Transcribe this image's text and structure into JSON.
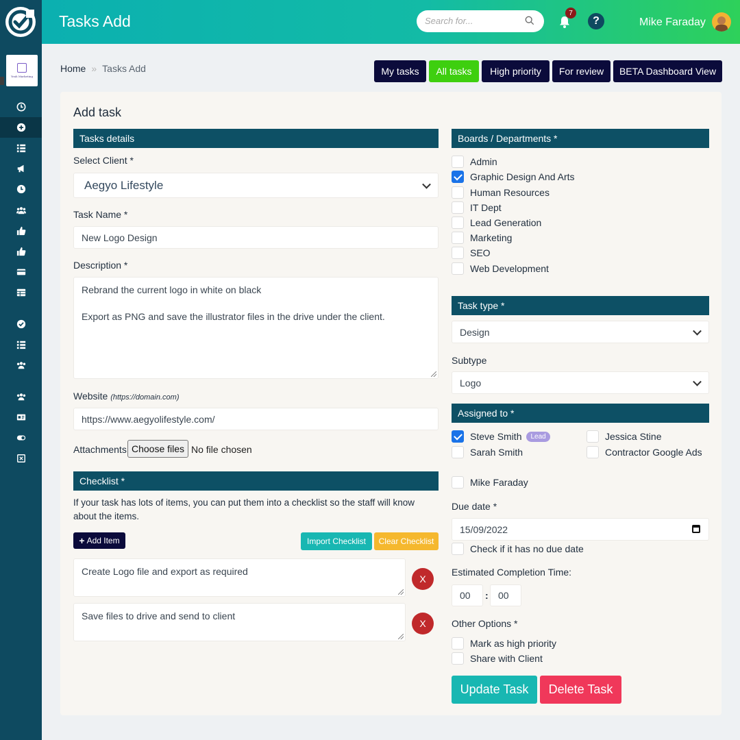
{
  "header": {
    "title": "Tasks Add",
    "search_placeholder": "Search for...",
    "notification_count": "7",
    "help_label": "?",
    "user_name": "Mike Faraday"
  },
  "sidebar": {
    "company_name": "Yeah Marketing",
    "icons": [
      "clock-icon",
      "plus-circle-icon",
      "list-icon",
      "megaphone-icon",
      "clock-icon",
      "users-icon",
      "thumbs-up-icon",
      "thumbs-up-icon",
      "credit-card-icon",
      "table-icon",
      "check-circle-icon",
      "list-icon",
      "users-icon",
      "users-icon",
      "id-card-icon",
      "toggle-icon",
      "close-square-icon"
    ]
  },
  "breadcrumb": {
    "home": "Home",
    "separator": "»",
    "current": "Tasks Add"
  },
  "top_buttons": [
    "My tasks",
    "All tasks",
    "High priority",
    "For review",
    "BETA Dashboard View"
  ],
  "form": {
    "title": "Add task",
    "task_details_header": "Tasks details",
    "client_label": "Select Client *",
    "client_value": "Aegyo Lifestyle",
    "task_name_label": "Task Name *",
    "task_name_value": "New Logo Design",
    "description_label": "Description *",
    "description_line1": "Rebrand the current logo in white on black",
    "description_line2": "Export as PNG and save the illustrator files in the drive under the client.",
    "website_label": "Website",
    "website_hint": "(https://domain.com)",
    "website_value": "https://www.aegyolifestyle.com/",
    "attachments_label": "Attachments",
    "choose_files": "Choose files",
    "no_file": "No file chosen",
    "checklist_header": "Checklist *",
    "checklist_help": "If your task has lots of items, you can put them into a checklist so the staff will know about the items.",
    "add_item": "Add Item",
    "import_checklist": "Import Checklist",
    "clear_checklist": "Clear Checklist",
    "checklist_items": [
      "Create Logo file and export as required",
      "Save files to drive and send to client"
    ],
    "remove_label": "X",
    "boards_header": "Boards / Departments *",
    "boards": [
      {
        "label": "Admin",
        "checked": false
      },
      {
        "label": "Graphic Design And Arts",
        "checked": true
      },
      {
        "label": "Human Resources",
        "checked": false
      },
      {
        "label": "IT Dept",
        "checked": false
      },
      {
        "label": "Lead Generation",
        "checked": false
      },
      {
        "label": "Marketing",
        "checked": false
      },
      {
        "label": "SEO",
        "checked": false
      },
      {
        "label": "Web Development",
        "checked": false
      }
    ],
    "task_type_header": "Task type *",
    "task_type_value": "Design",
    "subtype_label": "Subtype",
    "subtype_value": "Logo",
    "assigned_header": "Assigned to *",
    "assignees": [
      {
        "label": "Steve Smith",
        "checked": true,
        "badge": "Lead"
      },
      {
        "label": "Jessica Stine",
        "checked": false
      },
      {
        "label": "Sarah Smith",
        "checked": false
      },
      {
        "label": "Contractor Google Ads",
        "checked": false
      },
      {
        "label": "Mike Faraday",
        "checked": false
      }
    ],
    "due_date_label": "Due date *",
    "due_date_value": "15/09/2022",
    "no_due_date_label": "Check if it has no due date",
    "estimated_label": "Estimated Completion Time:",
    "est_hours": "00",
    "est_colon": ":",
    "est_minutes": "00",
    "other_options_label": "Other Options *",
    "high_priority_label": "Mark as high priority",
    "share_client_label": "Share with Client",
    "update_button": "Update Task",
    "delete_button": "Delete Task"
  },
  "colors": {
    "sidebar": "#0e4a60",
    "section_bar": "#0d5065",
    "header_gradient_start": "#0bb0b0",
    "header_gradient_end": "#2ed15a",
    "dark_button": "#0b0b3b",
    "green_button": "#3ecf0f",
    "teal_button": "#18b7b2",
    "yellow_button": "#f5b82e",
    "danger": "#f0385a",
    "checkbox_checked": "#1a73e8"
  }
}
